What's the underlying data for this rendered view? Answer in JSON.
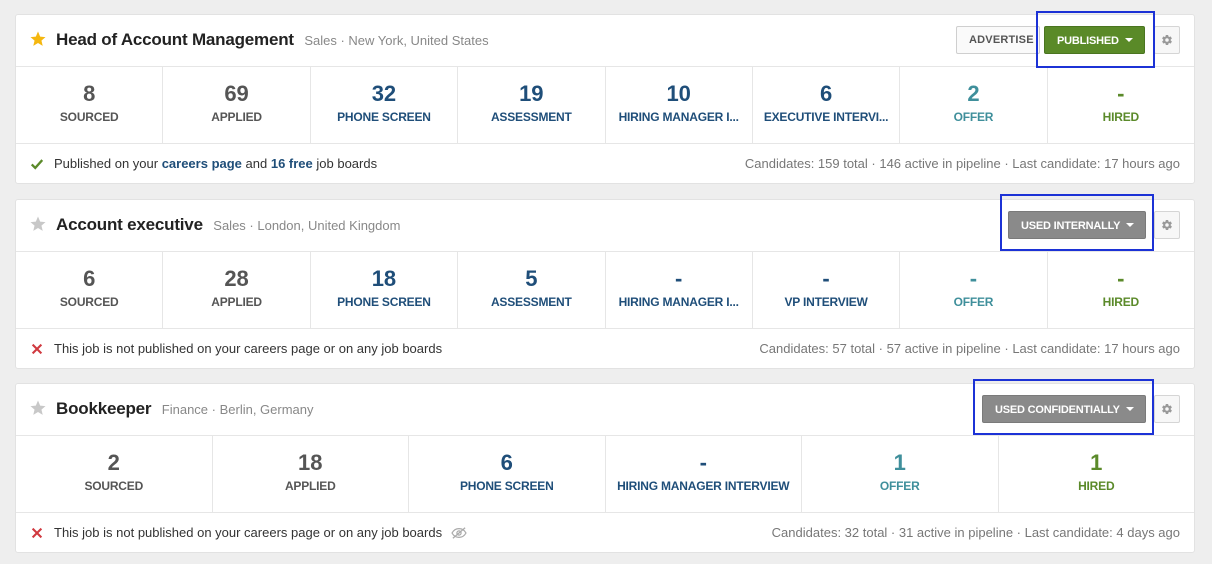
{
  "jobs": [
    {
      "title": "Head of Account Management",
      "meta": "Sales · New York, United States",
      "starred": true,
      "advertise_label": "ADVERTISE",
      "status_label": "PUBLISHED",
      "status_color": "#5a8a28",
      "stats": [
        {
          "value": "8",
          "label": "SOURCED"
        },
        {
          "value": "69",
          "label": "APPLIED"
        },
        {
          "value": "32",
          "label": "PHONE SCREEN"
        },
        {
          "value": "19",
          "label": "ASSESSMENT"
        },
        {
          "value": "10",
          "label": "HIRING MANAGER I..."
        },
        {
          "value": "6",
          "label": "EXECUTIVE INTERVI..."
        },
        {
          "value": "2",
          "label": "OFFER"
        },
        {
          "value": "-",
          "label": "HIRED"
        }
      ],
      "footer": {
        "pre": "Published on your ",
        "link1": "careers page",
        "mid": " and ",
        "link2": "16 free",
        "post": " job boards",
        "summary": "Candidates: 159 total · 146 active in pipeline · Last candidate: 17 hours ago"
      }
    },
    {
      "title": "Account executive",
      "meta": "Sales · London, United Kingdom",
      "starred": false,
      "status_label": "USED INTERNALLY",
      "status_color": "#8a8a8a",
      "stats": [
        {
          "value": "6",
          "label": "SOURCED"
        },
        {
          "value": "28",
          "label": "APPLIED"
        },
        {
          "value": "18",
          "label": "PHONE SCREEN"
        },
        {
          "value": "5",
          "label": "ASSESSMENT"
        },
        {
          "value": "-",
          "label": "HIRING MANAGER I..."
        },
        {
          "value": "-",
          "label": "VP INTERVIEW"
        },
        {
          "value": "-",
          "label": "OFFER"
        },
        {
          "value": "-",
          "label": "HIRED"
        }
      ],
      "footer": {
        "text": "This job is not published on your careers page or on any job boards",
        "summary": "Candidates: 57 total · 57 active in pipeline · Last candidate: 17 hours ago"
      }
    },
    {
      "title": "Bookkeeper",
      "meta": "Finance · Berlin, Germany",
      "starred": false,
      "status_label": "USED CONFIDENTIALLY",
      "status_color": "#8a8a8a",
      "stats": [
        {
          "value": "2",
          "label": "SOURCED"
        },
        {
          "value": "18",
          "label": "APPLIED"
        },
        {
          "value": "6",
          "label": "PHONE SCREEN"
        },
        {
          "value": "-",
          "label": "HIRING MANAGER INTERVIEW"
        },
        {
          "value": "1",
          "label": "OFFER"
        },
        {
          "value": "1",
          "label": "HIRED"
        }
      ],
      "footer": {
        "text": "This job is not published on your careers page or on any job boards",
        "summary": "Candidates: 32 total · 31 active in pipeline · Last candidate: 4 days ago"
      }
    }
  ],
  "colors": {
    "star_active": "#f5b70f",
    "star_inactive": "#c8c8c8",
    "check": "#5b8a2a",
    "cross": "#d0393f",
    "highlight": "#1c32d6"
  }
}
